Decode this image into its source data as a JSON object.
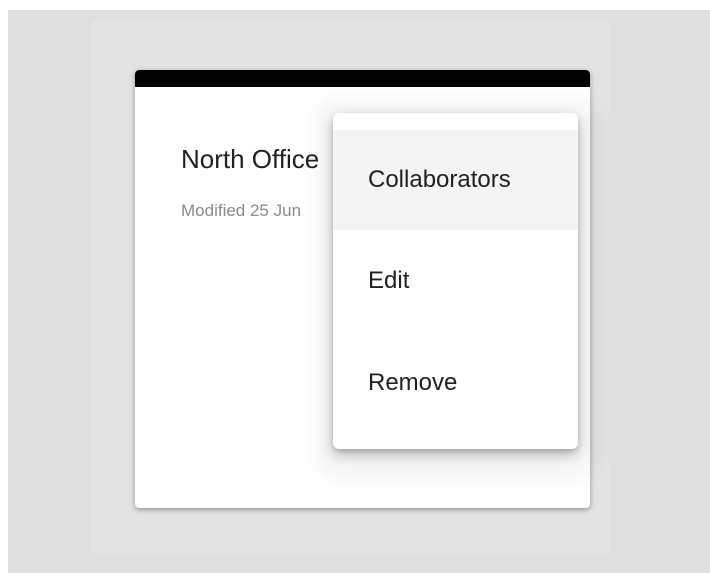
{
  "card": {
    "title": "North Office",
    "subtitle": "Modified 25 Jun"
  },
  "menu": {
    "items": [
      {
        "label": "Collaborators"
      },
      {
        "label": "Edit"
      },
      {
        "label": "Remove"
      }
    ]
  }
}
